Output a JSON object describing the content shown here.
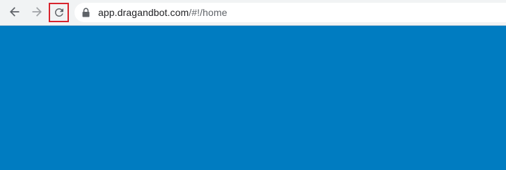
{
  "toolbar": {
    "back_icon": "arrow-left-icon",
    "forward_icon": "arrow-right-icon",
    "reload_icon": "reload-icon",
    "lock_icon": "lock-icon"
  },
  "address_bar": {
    "host": "app.dragandbot.com",
    "path": "/#!/home"
  },
  "page": {
    "background_color": "#007cc1"
  },
  "colors": {
    "highlight": "#d8242d",
    "toolbar_bg": "#f1f3f4"
  }
}
